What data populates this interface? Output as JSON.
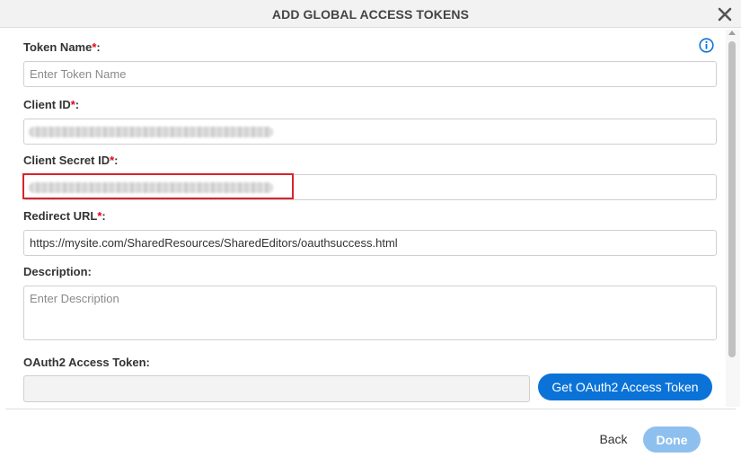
{
  "dialog": {
    "title": "ADD GLOBAL ACCESS TOKENS",
    "close_icon": "close-icon",
    "info_icon": "info-icon"
  },
  "fields": {
    "token_name": {
      "label": "Token Name",
      "required_mark": "*",
      "suffix": ":",
      "placeholder": "Enter Token Name",
      "value": ""
    },
    "client_id": {
      "label": "Client ID",
      "required_mark": "*",
      "suffix": ":",
      "value_state": "redacted"
    },
    "client_secret_id": {
      "label": "Client Secret ID",
      "required_mark": "*",
      "suffix": ":",
      "value_state": "redacted"
    },
    "redirect_url": {
      "label": "Redirect URL",
      "required_mark": "*",
      "suffix": ":",
      "value": "https://mysite.com/SharedResources/SharedEditors/oauthsuccess.html"
    },
    "description": {
      "label": "Description:",
      "placeholder": "Enter Description",
      "value": ""
    },
    "oauth2_token": {
      "label": "OAuth2 Access Token:",
      "value": ""
    }
  },
  "buttons": {
    "get_token": "Get OAuth2 Access Token",
    "back": "Back",
    "done": "Done"
  },
  "colors": {
    "primary": "#0b73d8",
    "primary_disabled": "#8dc0ee",
    "required": "#e0001b",
    "highlight": "#d9232e"
  }
}
